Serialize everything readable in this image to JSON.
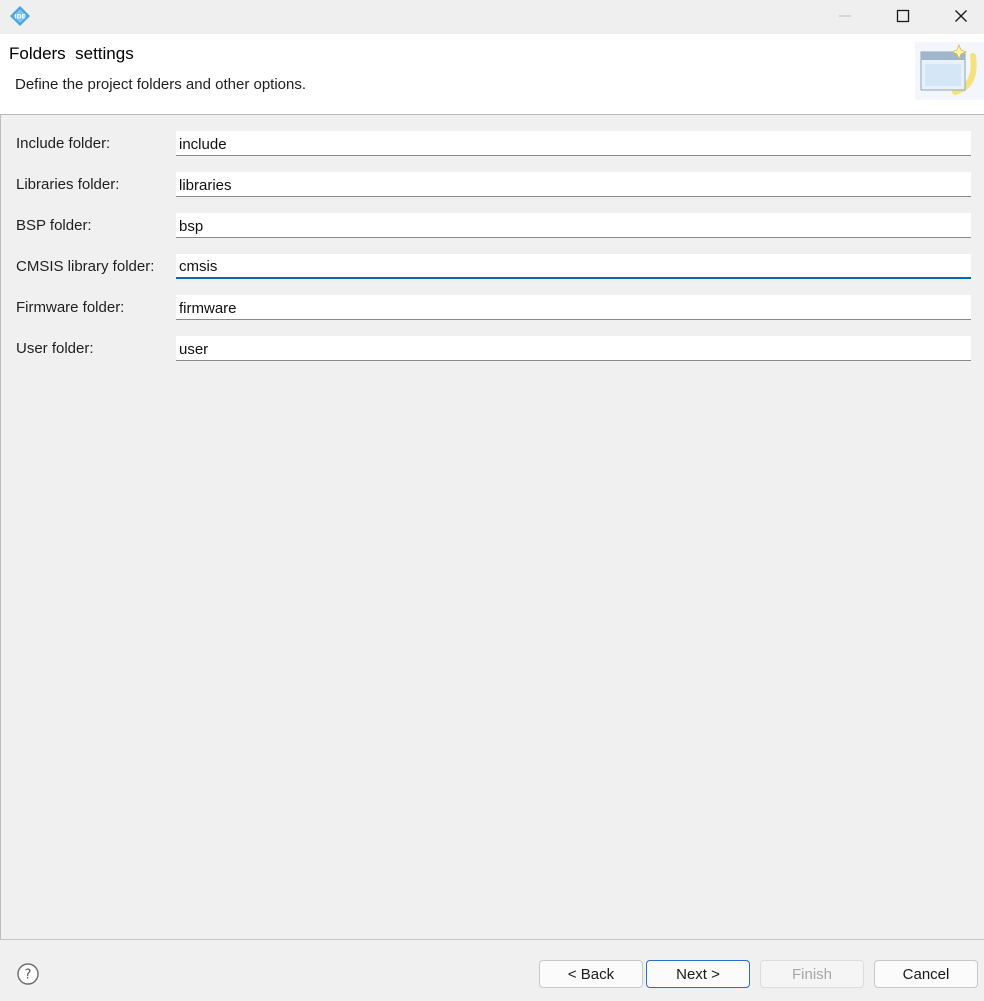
{
  "window": {
    "app_icon": "ide-logo-icon",
    "controls": {
      "minimize": "minimize-icon",
      "maximize": "maximize-icon",
      "close": "close-icon"
    }
  },
  "header": {
    "title": "Folders  settings",
    "description": "Define the project folders and other options.",
    "banner_icon": "wizard-banner-icon"
  },
  "form": {
    "fields": [
      {
        "label": "Include folder:",
        "value": "include"
      },
      {
        "label": "Libraries folder:",
        "value": "libraries"
      },
      {
        "label": "BSP folder:",
        "value": "bsp"
      },
      {
        "label": "CMSIS library folder:",
        "value": "cmsis"
      },
      {
        "label": "Firmware folder:",
        "value": "firmware"
      },
      {
        "label": "User folder:",
        "value": "user"
      }
    ],
    "focused_field": "CMSIS library folder:"
  },
  "footer": {
    "help_icon": "help-icon",
    "back_label": "< Back",
    "next_label": "Next >",
    "finish_label": "Finish",
    "cancel_label": "Cancel",
    "finish_disabled": true
  },
  "colors": {
    "accent": "#0067c0",
    "background": "#f0f0f0",
    "header_bg": "#ffffff"
  }
}
